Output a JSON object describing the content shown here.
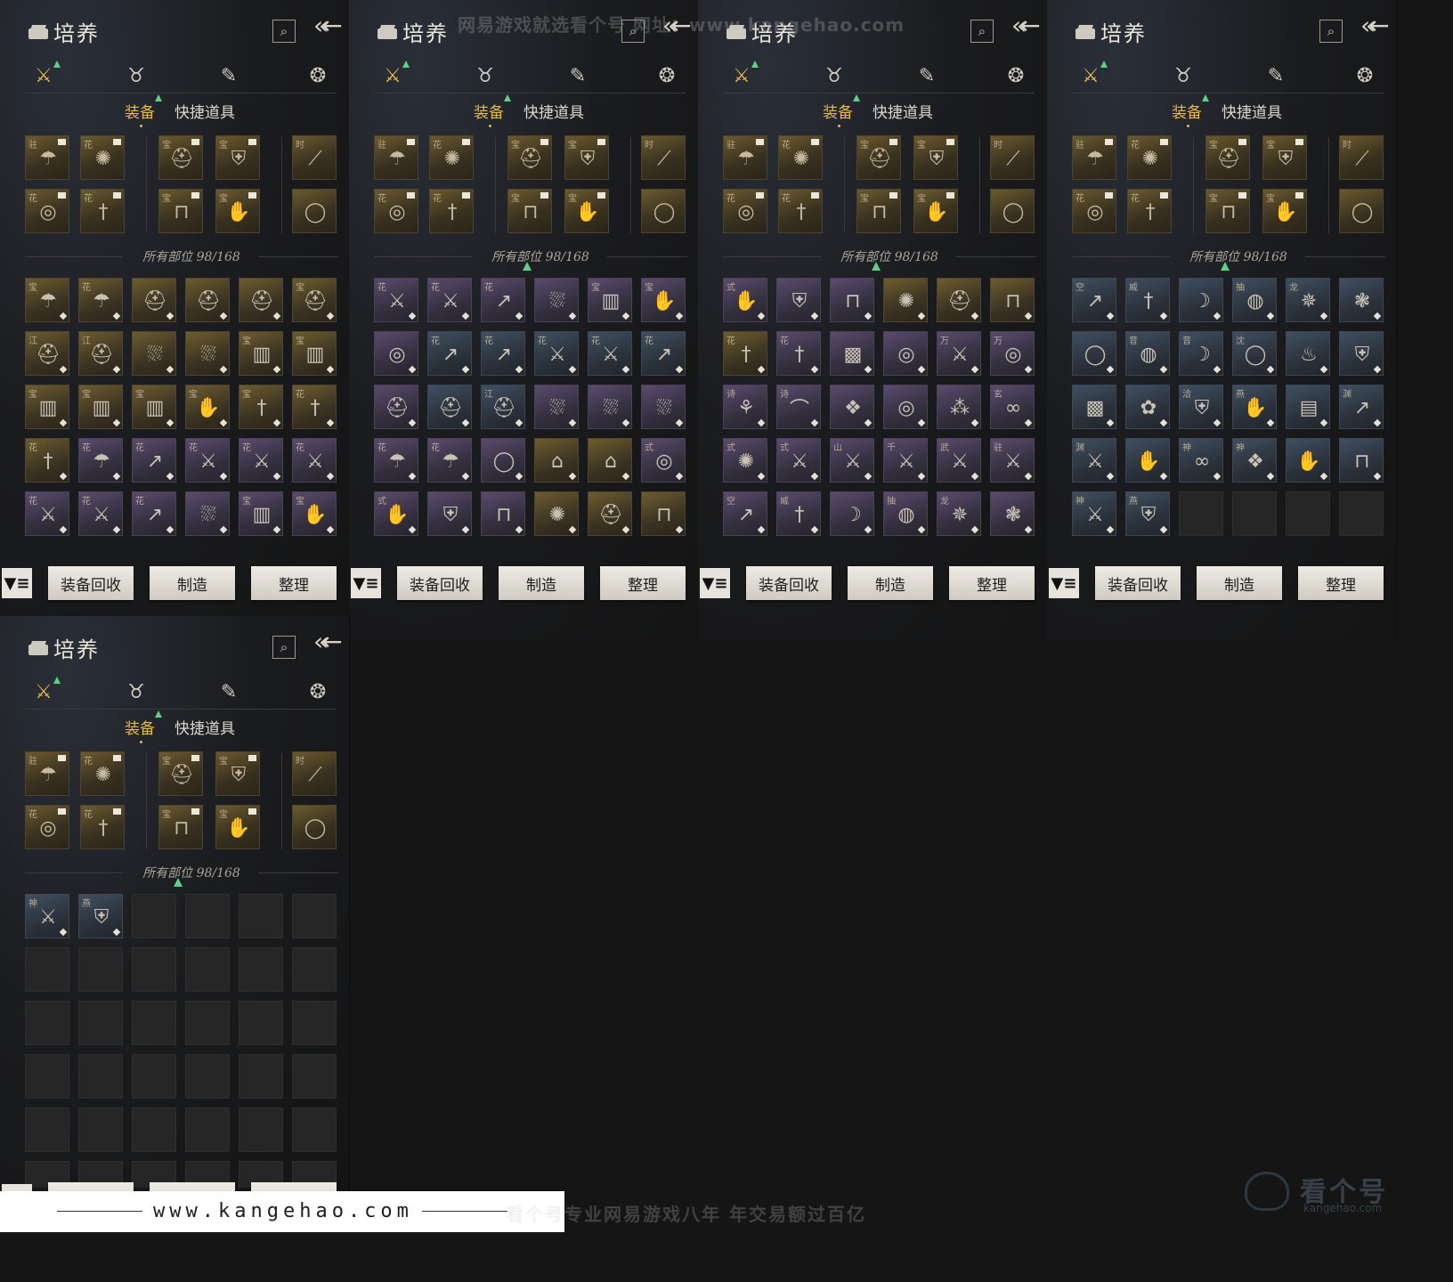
{
  "panel": {
    "title": "培养",
    "search_icon": "⌕",
    "back_icon": "«←",
    "category_tabs": [
      {
        "icon": "crossed-swords-icon",
        "glyph": "⚔"
      },
      {
        "icon": "bag-icon",
        "glyph": "♉"
      },
      {
        "icon": "scroll-icon",
        "glyph": "✎"
      },
      {
        "icon": "token-icon",
        "glyph": "❂"
      }
    ],
    "sub_tabs": [
      "装备",
      "快捷道具"
    ],
    "slot_count": "所有部位 98/168",
    "filter_icon": "▼≡",
    "buttons": [
      "装备回收",
      "制造",
      "整理"
    ]
  },
  "equipped_slots": {
    "tags": [
      "驻",
      "花",
      "宝",
      "宝",
      "时",
      "花",
      "花",
      "宝",
      "宝",
      ""
    ],
    "icons": [
      "umbrella",
      "fan",
      "helmet",
      "armor",
      "staff",
      "shield",
      "dagger",
      "greaves",
      "gauntlet",
      "ring"
    ]
  },
  "inventory_pages": [
    {
      "cells": [
        {
          "tag": "宝",
          "rarity": "gold",
          "icon": "umbrella"
        },
        {
          "tag": "花",
          "rarity": "gold",
          "icon": "umbrella"
        },
        {
          "tag": "",
          "rarity": "gold",
          "icon": "helmet"
        },
        {
          "tag": "",
          "rarity": "gold",
          "icon": "helmet"
        },
        {
          "tag": "",
          "rarity": "gold",
          "icon": "helmet"
        },
        {
          "tag": "宝",
          "rarity": "gold",
          "icon": "helmet"
        },
        {
          "tag": "江",
          "rarity": "gold",
          "icon": "helmet"
        },
        {
          "tag": "江",
          "rarity": "gold",
          "icon": "helmet"
        },
        {
          "tag": "",
          "rarity": "gold",
          "icon": "cloak"
        },
        {
          "tag": "",
          "rarity": "gold",
          "icon": "cloak"
        },
        {
          "tag": "宝",
          "rarity": "gold",
          "icon": "bracer"
        },
        {
          "tag": "宝",
          "rarity": "gold",
          "icon": "bracer"
        },
        {
          "tag": "宝",
          "rarity": "gold",
          "icon": "bracer"
        },
        {
          "tag": "宝",
          "rarity": "gold",
          "icon": "bracer"
        },
        {
          "tag": "宝",
          "rarity": "gold",
          "icon": "bracer"
        },
        {
          "tag": "宝",
          "rarity": "gold",
          "icon": "gauntlet"
        },
        {
          "tag": "宝",
          "rarity": "gold",
          "icon": "dagger"
        },
        {
          "tag": "花",
          "rarity": "gold",
          "icon": "dagger"
        },
        {
          "tag": "花",
          "rarity": "gold",
          "icon": "dagger"
        },
        {
          "tag": "花",
          "rarity": "purple",
          "icon": "umbrella"
        },
        {
          "tag": "花",
          "rarity": "purple",
          "icon": "spear"
        },
        {
          "tag": "花",
          "rarity": "purple",
          "icon": "sword"
        },
        {
          "tag": "花",
          "rarity": "purple",
          "icon": "sword"
        },
        {
          "tag": "花",
          "rarity": "purple",
          "icon": "sword"
        },
        {
          "tag": "花",
          "rarity": "purple",
          "icon": "sword"
        },
        {
          "tag": "花",
          "rarity": "purple",
          "icon": "sword"
        },
        {
          "tag": "花",
          "rarity": "purple",
          "icon": "spear"
        },
        {
          "tag": "",
          "rarity": "purple",
          "icon": "cloak"
        },
        {
          "tag": "宝",
          "rarity": "purple",
          "icon": "bracer"
        },
        {
          "tag": "宝",
          "rarity": "purple",
          "icon": "gauntlet"
        }
      ]
    },
    {
      "cells": [
        {
          "tag": "花",
          "rarity": "purple",
          "icon": "sword"
        },
        {
          "tag": "花",
          "rarity": "purple",
          "icon": "sword"
        },
        {
          "tag": "花",
          "rarity": "purple",
          "icon": "spear"
        },
        {
          "tag": "",
          "rarity": "purple",
          "icon": "cloak"
        },
        {
          "tag": "宝",
          "rarity": "purple",
          "icon": "bracer"
        },
        {
          "tag": "宝",
          "rarity": "purple",
          "icon": "gauntlet"
        },
        {
          "tag": "",
          "rarity": "purple",
          "icon": "shield"
        },
        {
          "tag": "花",
          "rarity": "blue",
          "icon": "spear"
        },
        {
          "tag": "花",
          "rarity": "blue",
          "icon": "spear"
        },
        {
          "tag": "花",
          "rarity": "blue",
          "icon": "sword"
        },
        {
          "tag": "花",
          "rarity": "blue",
          "icon": "sword"
        },
        {
          "tag": "花",
          "rarity": "blue",
          "icon": "spear"
        },
        {
          "tag": "",
          "rarity": "purple",
          "icon": "helmet"
        },
        {
          "tag": "",
          "rarity": "blue",
          "icon": "helmet"
        },
        {
          "tag": "江",
          "rarity": "blue",
          "icon": "helmet"
        },
        {
          "tag": "",
          "rarity": "purple",
          "icon": "cloak"
        },
        {
          "tag": "",
          "rarity": "purple",
          "icon": "cloak"
        },
        {
          "tag": "",
          "rarity": "purple",
          "icon": "cloak"
        },
        {
          "tag": "花",
          "rarity": "purple",
          "icon": "umbrella"
        },
        {
          "tag": "花",
          "rarity": "purple",
          "icon": "umbrella"
        },
        {
          "tag": "",
          "rarity": "purple",
          "icon": "ring"
        },
        {
          "tag": "",
          "rarity": "gold",
          "icon": "charm"
        },
        {
          "tag": "",
          "rarity": "gold",
          "icon": "charm"
        },
        {
          "tag": "式",
          "rarity": "purple",
          "icon": "shield"
        },
        {
          "tag": "式",
          "rarity": "purple",
          "icon": "gauntlet"
        },
        {
          "tag": "",
          "rarity": "purple",
          "icon": "armor"
        },
        {
          "tag": "",
          "rarity": "purple",
          "icon": "greaves"
        },
        {
          "tag": "",
          "rarity": "gold",
          "icon": "fan"
        },
        {
          "tag": "",
          "rarity": "gold",
          "icon": "helmet"
        },
        {
          "tag": "",
          "rarity": "gold",
          "icon": "greaves"
        }
      ]
    },
    {
      "cells": [
        {
          "tag": "式",
          "rarity": "purple",
          "icon": "gauntlet"
        },
        {
          "tag": "",
          "rarity": "purple",
          "icon": "armor"
        },
        {
          "tag": "",
          "rarity": "purple",
          "icon": "greaves"
        },
        {
          "tag": "",
          "rarity": "gold",
          "icon": "fan"
        },
        {
          "tag": "",
          "rarity": "gold",
          "icon": "helmet"
        },
        {
          "tag": "",
          "rarity": "gold",
          "icon": "greaves"
        },
        {
          "tag": "花",
          "rarity": "gold",
          "icon": "dagger"
        },
        {
          "tag": "花",
          "rarity": "purple",
          "icon": "dagger"
        },
        {
          "tag": "",
          "rarity": "purple",
          "icon": "cloth"
        },
        {
          "tag": "",
          "rarity": "purple",
          "icon": "jade-ring"
        },
        {
          "tag": "万",
          "rarity": "purple",
          "icon": "sword"
        },
        {
          "tag": "万",
          "rarity": "purple",
          "icon": "jade-ring"
        },
        {
          "tag": "诗",
          "rarity": "purple",
          "icon": "hairpin"
        },
        {
          "tag": "诗",
          "rarity": "purple",
          "icon": "necklace"
        },
        {
          "tag": "",
          "rarity": "purple",
          "icon": "jade"
        },
        {
          "tag": "",
          "rarity": "purple",
          "icon": "jade-ring"
        },
        {
          "tag": "",
          "rarity": "purple",
          "icon": "grapes"
        },
        {
          "tag": "玄",
          "rarity": "purple",
          "icon": "rope"
        },
        {
          "tag": "式",
          "rarity": "purple",
          "icon": "fan"
        },
        {
          "tag": "式",
          "rarity": "purple",
          "icon": "sword"
        },
        {
          "tag": "山",
          "rarity": "purple",
          "icon": "sword"
        },
        {
          "tag": "千",
          "rarity": "purple",
          "icon": "sword"
        },
        {
          "tag": "武",
          "rarity": "purple",
          "icon": "sword"
        },
        {
          "tag": "驻",
          "rarity": "purple",
          "icon": "sword"
        },
        {
          "tag": "空",
          "rarity": "purple",
          "icon": "spear"
        },
        {
          "tag": "威",
          "rarity": "purple",
          "icon": "dagger"
        },
        {
          "tag": "",
          "rarity": "purple",
          "icon": "bow"
        },
        {
          "tag": "抽",
          "rarity": "purple",
          "icon": "pouch"
        },
        {
          "tag": "龙",
          "rarity": "purple",
          "icon": "dragon"
        },
        {
          "tag": "",
          "rarity": "purple",
          "icon": "lace"
        }
      ]
    },
    {
      "cells": [
        {
          "tag": "空",
          "rarity": "blue",
          "icon": "spear"
        },
        {
          "tag": "威",
          "rarity": "blue",
          "icon": "dagger"
        },
        {
          "tag": "",
          "rarity": "blue",
          "icon": "bow"
        },
        {
          "tag": "抽",
          "rarity": "blue",
          "icon": "pouch"
        },
        {
          "tag": "龙",
          "rarity": "blue",
          "icon": "dragon"
        },
        {
          "tag": "",
          "rarity": "blue",
          "icon": "lace"
        },
        {
          "tag": "",
          "rarity": "blue",
          "icon": "ring"
        },
        {
          "tag": "音",
          "rarity": "blue",
          "icon": "pouch"
        },
        {
          "tag": "音",
          "rarity": "blue",
          "icon": "bow"
        },
        {
          "tag": "沈",
          "rarity": "blue",
          "icon": "ring"
        },
        {
          "tag": "",
          "rarity": "blue",
          "icon": "coral"
        },
        {
          "tag": "",
          "rarity": "blue",
          "icon": "armor"
        },
        {
          "tag": "",
          "rarity": "blue",
          "icon": "cloth"
        },
        {
          "tag": "",
          "rarity": "blue",
          "icon": "flower"
        },
        {
          "tag": "洽",
          "rarity": "blue",
          "icon": "armor"
        },
        {
          "tag": "燕",
          "rarity": "blue",
          "icon": "gauntlet"
        },
        {
          "tag": "",
          "rarity": "blue",
          "icon": "paper"
        },
        {
          "tag": "渊",
          "rarity": "blue",
          "icon": "spear"
        },
        {
          "tag": "渊",
          "rarity": "blue",
          "icon": "sword"
        },
        {
          "tag": "",
          "rarity": "blue",
          "icon": "gauntlet"
        },
        {
          "tag": "神",
          "rarity": "blue",
          "icon": "rope"
        },
        {
          "tag": "神",
          "rarity": "blue",
          "icon": "jade"
        },
        {
          "tag": "",
          "rarity": "blue",
          "icon": "gauntlet"
        },
        {
          "tag": "",
          "rarity": "blue",
          "icon": "greaves"
        },
        {
          "tag": "神",
          "rarity": "blue",
          "icon": "sword"
        },
        {
          "tag": "燕",
          "rarity": "blue",
          "icon": "armor"
        },
        {
          "tag": "",
          "rarity": "empty",
          "icon": ""
        },
        {
          "tag": "",
          "rarity": "empty",
          "icon": ""
        },
        {
          "tag": "",
          "rarity": "empty",
          "icon": ""
        },
        {
          "tag": "",
          "rarity": "empty",
          "icon": ""
        }
      ]
    },
    {
      "cells": [
        {
          "tag": "神",
          "rarity": "blue",
          "icon": "sword"
        },
        {
          "tag": "燕",
          "rarity": "blue",
          "icon": "armor"
        },
        {
          "tag": "",
          "rarity": "empty",
          "icon": ""
        },
        {
          "tag": "",
          "rarity": "empty",
          "icon": ""
        },
        {
          "tag": "",
          "rarity": "empty",
          "icon": ""
        },
        {
          "tag": "",
          "rarity": "empty",
          "icon": ""
        },
        {
          "tag": "",
          "rarity": "empty",
          "icon": ""
        },
        {
          "tag": "",
          "rarity": "empty",
          "icon": ""
        },
        {
          "tag": "",
          "rarity": "empty",
          "icon": ""
        },
        {
          "tag": "",
          "rarity": "empty",
          "icon": ""
        },
        {
          "tag": "",
          "rarity": "empty",
          "icon": ""
        },
        {
          "tag": "",
          "rarity": "empty",
          "icon": ""
        },
        {
          "tag": "",
          "rarity": "empty",
          "icon": ""
        },
        {
          "tag": "",
          "rarity": "empty",
          "icon": ""
        },
        {
          "tag": "",
          "rarity": "empty",
          "icon": ""
        },
        {
          "tag": "",
          "rarity": "empty",
          "icon": ""
        },
        {
          "tag": "",
          "rarity": "empty",
          "icon": ""
        },
        {
          "tag": "",
          "rarity": "empty",
          "icon": ""
        },
        {
          "tag": "",
          "rarity": "empty",
          "icon": ""
        },
        {
          "tag": "",
          "rarity": "empty",
          "icon": ""
        },
        {
          "tag": "",
          "rarity": "empty",
          "icon": ""
        },
        {
          "tag": "",
          "rarity": "empty",
          "icon": ""
        },
        {
          "tag": "",
          "rarity": "empty",
          "icon": ""
        },
        {
          "tag": "",
          "rarity": "empty",
          "icon": ""
        },
        {
          "tag": "",
          "rarity": "empty",
          "icon": ""
        },
        {
          "tag": "",
          "rarity": "empty",
          "icon": ""
        },
        {
          "tag": "",
          "rarity": "empty",
          "icon": ""
        },
        {
          "tag": "",
          "rarity": "empty",
          "icon": ""
        },
        {
          "tag": "",
          "rarity": "empty",
          "icon": ""
        },
        {
          "tag": "",
          "rarity": "empty",
          "icon": ""
        },
        {
          "tag": "",
          "rarity": "empty",
          "icon": ""
        },
        {
          "tag": "",
          "rarity": "empty",
          "icon": ""
        },
        {
          "tag": "",
          "rarity": "empty",
          "icon": ""
        },
        {
          "tag": "",
          "rarity": "empty",
          "icon": ""
        },
        {
          "tag": "",
          "rarity": "empty",
          "icon": ""
        },
        {
          "tag": "",
          "rarity": "empty",
          "icon": ""
        }
      ]
    }
  ],
  "icon_glyphs": {
    "umbrella": "☂",
    "fan": "✺",
    "helmet": "⛑",
    "armor": "⛨",
    "staff": "⟋",
    "shield": "◎",
    "dagger": "†",
    "greaves": "⊓",
    "gauntlet": "✋",
    "ring": "◯",
    "cloak": "⛆",
    "bracer": "▥",
    "spear": "↗",
    "sword": "⚔",
    "charm": "⌂",
    "cloth": "▩",
    "jade-ring": "◎",
    "hairpin": "⚘",
    "necklace": "⌒",
    "jade": "❖",
    "grapes": "⁂",
    "rope": "∞",
    "bow": "☽",
    "pouch": "◍",
    "dragon": "✵",
    "lace": "❃",
    "coral": "♨",
    "flower": "✿",
    "paper": "▤"
  },
  "watermark": {
    "top": "网易游戏就选看个号 网址：www.kangehao.com",
    "footer_url": "www.kangehao.com",
    "footer_slogan": "看个号专业网易游戏八年  年交易额过百亿",
    "logo_text": "看个号",
    "logo_sub": "kangehao.com"
  },
  "colors": {
    "accent_gold": "#e8b94a",
    "new_indicator": "#5fd08a"
  }
}
